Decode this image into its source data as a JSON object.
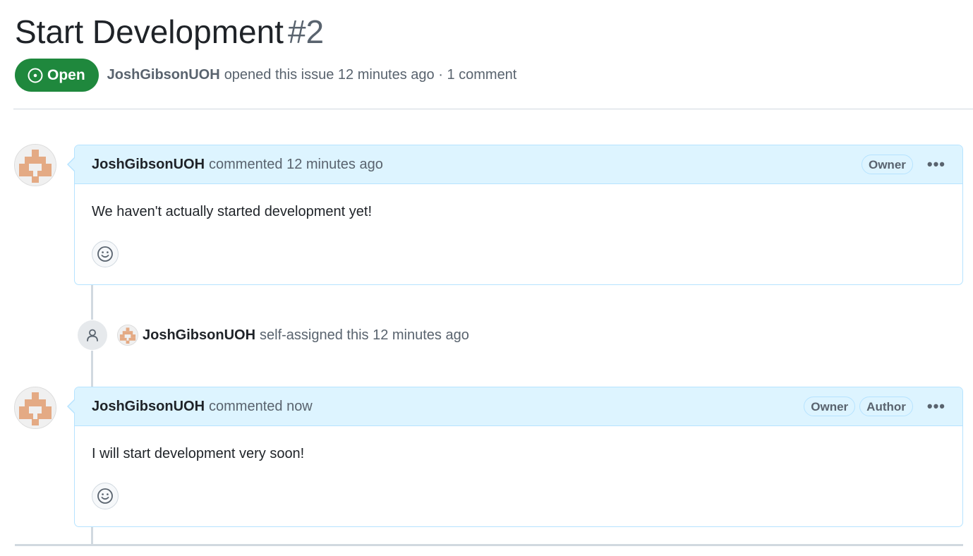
{
  "issue": {
    "title": "Start Development",
    "number": "#2",
    "state_label": "Open",
    "state_color": "#1f883d",
    "author": "JoshGibsonUOH",
    "meta": "opened this issue 12 minutes ago · 1 comment"
  },
  "timeline": {
    "comment1": {
      "author": "JoshGibsonUOH",
      "action": "commented 12 minutes ago",
      "roles": [
        "Owner"
      ],
      "body": "We haven't actually started development yet!",
      "reaction_icon": "smiley-icon"
    },
    "event": {
      "icon": "person-icon",
      "author": "JoshGibsonUOH",
      "text": "self-assigned this 12 minutes ago"
    },
    "comment2": {
      "author": "JoshGibsonUOH",
      "action": "commented now",
      "roles": [
        "Owner",
        "Author"
      ],
      "body": "I will start development very soon!",
      "reaction_icon": "smiley-icon"
    }
  },
  "colors": {
    "accent_header": "#ddf4ff",
    "accent_border": "#b6e3ff",
    "avatar_pixel": "#e4aa84"
  }
}
